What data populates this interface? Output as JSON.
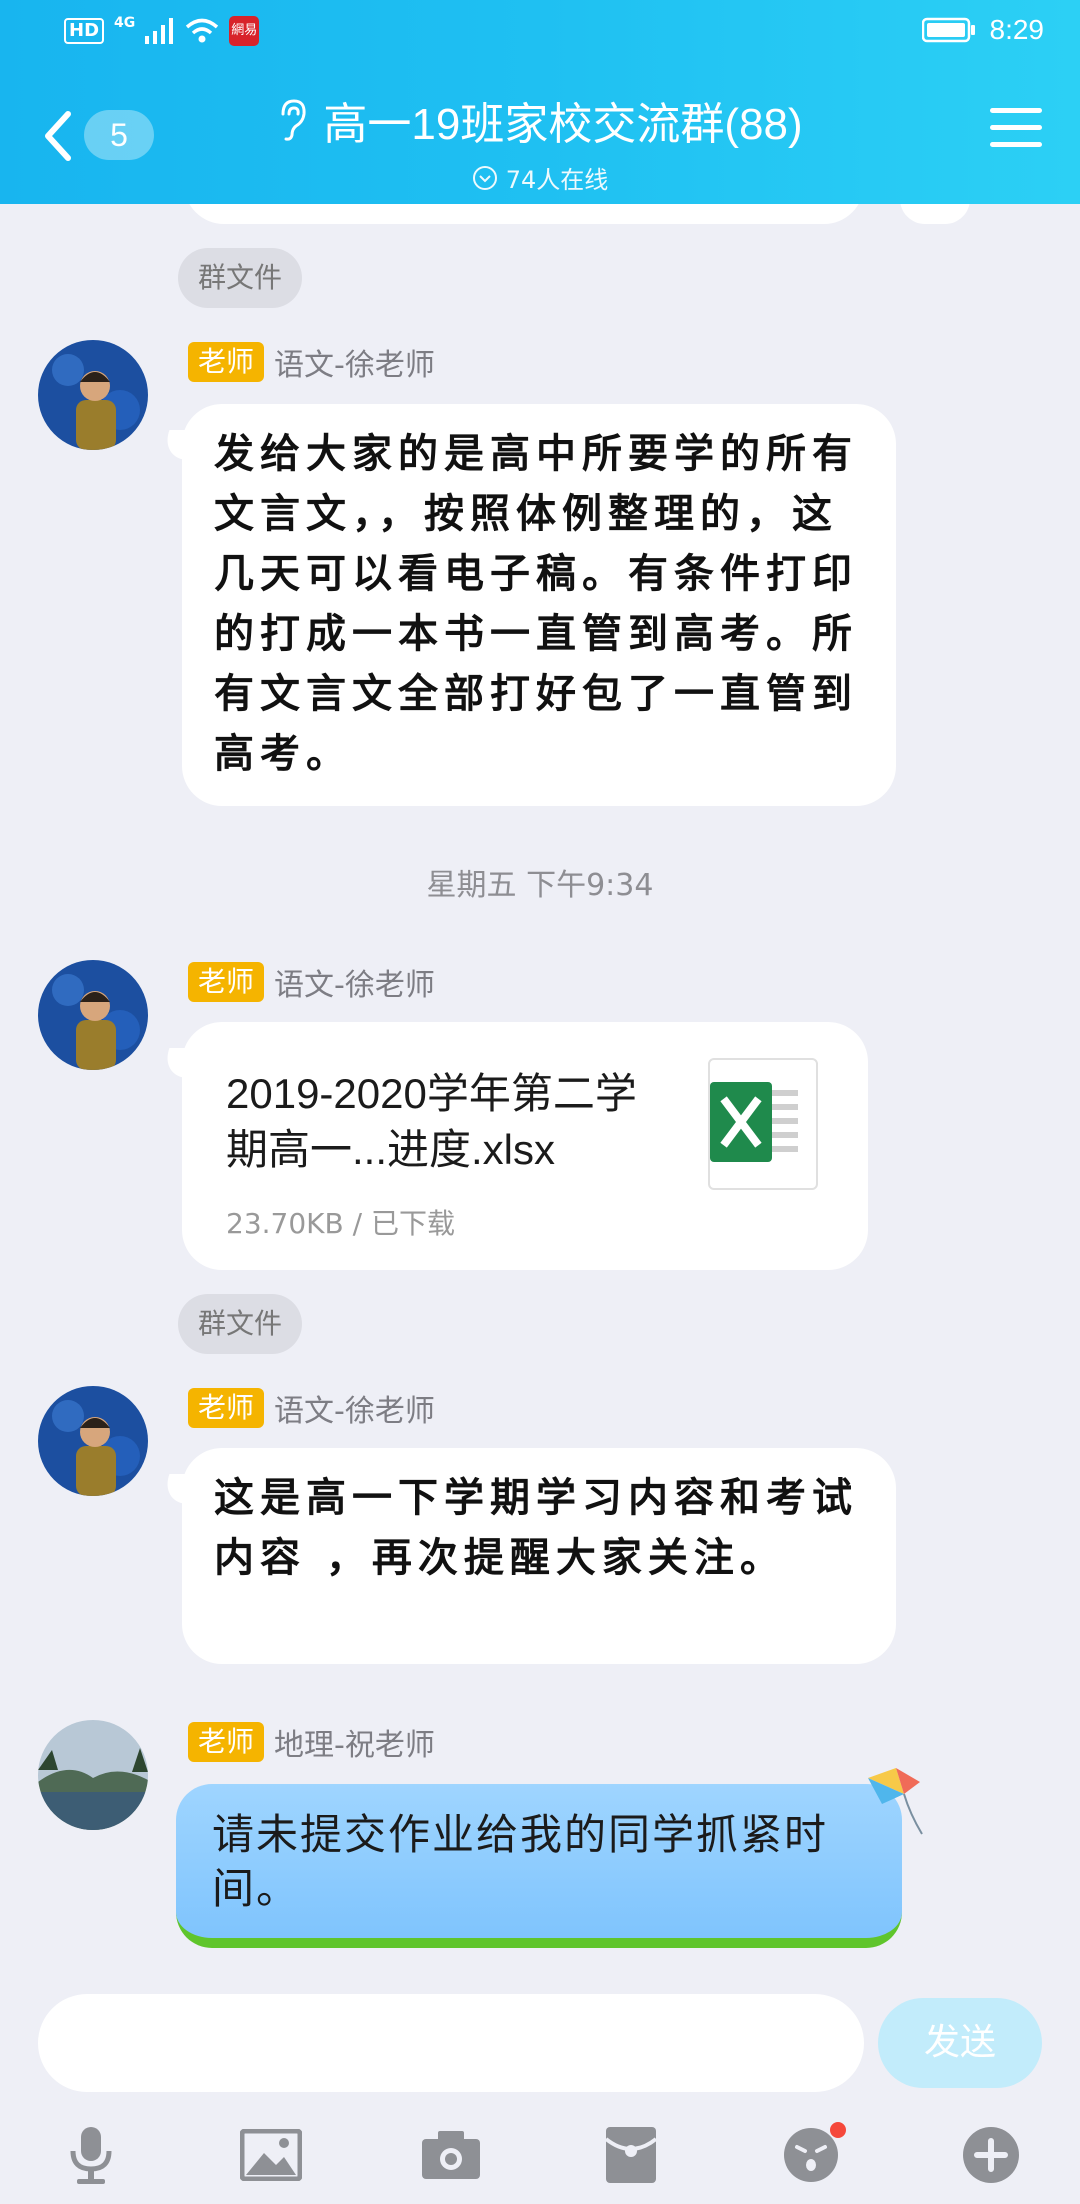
{
  "status_bar": {
    "hd": "HD",
    "network": "4G",
    "app_badge": "網易",
    "time": "8:29"
  },
  "header": {
    "back_badge": "5",
    "title": "高一19班家校交流群(88)",
    "online": "74人在线"
  },
  "colors": {
    "header_start": "#18b5ef",
    "header_end": "#2cd0f5",
    "role_badge": "#f5b400",
    "geo_bubble": "#8ccbfe"
  },
  "messages": {
    "tag1": "群文件",
    "m1": {
      "role": "老师",
      "sender": "语文-徐老师",
      "text": "发给大家的是高中所要学的所有文言文，，按照体例整理的，这几天可以看电子稿。有条件打印的打成一本书一直管到高考。所有文言文全部打好包了一直管到高考。"
    },
    "time_sep": "星期五 下午9:34",
    "m2": {
      "role": "老师",
      "sender": "语文-徐老师",
      "file_name": "2019-2020学年第二学期高一...进度.xlsx",
      "file_size": "23.70KB / 已下载",
      "file_icon": "excel-icon"
    },
    "tag2": "群文件",
    "m3": {
      "role": "老师",
      "sender": "语文-徐老师",
      "text": "这是高一下学期学习内容和考试内容 ，再次提醒大家关注。"
    },
    "m4": {
      "role": "老师",
      "sender": "地理-祝老师",
      "text": "请未提交作业给我的同学抓紧时间。"
    }
  },
  "input": {
    "placeholder": "",
    "send_label": "发送"
  },
  "toolbar": [
    "microphone-icon",
    "image-icon",
    "camera-icon",
    "red-packet-icon",
    "emoji-icon",
    "plus-icon"
  ]
}
